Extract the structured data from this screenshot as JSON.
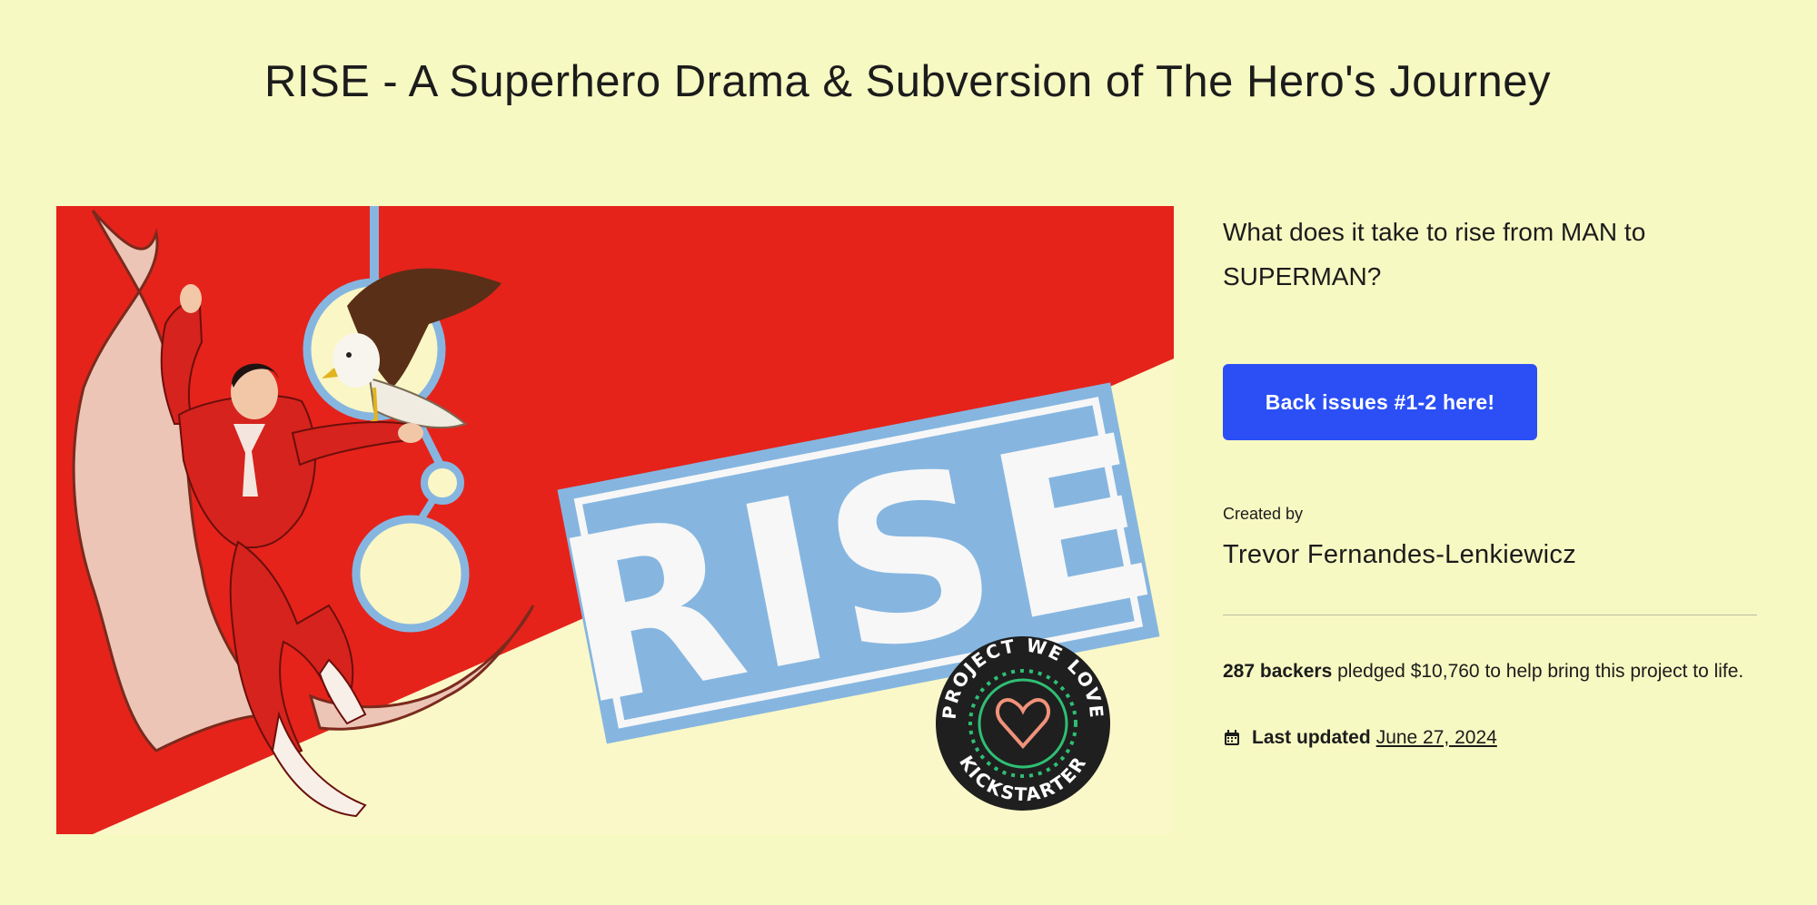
{
  "project": {
    "title": "RISE - A Superhero Drama & Subversion of The Hero's Journey",
    "blurb": "What does it take to rise from MAN to SUPERMAN?"
  },
  "hero_image": {
    "logo_text": "RISE",
    "badge_top_text": "PROJECT WE LOVE",
    "badge_bottom_text": "KICKSTARTER"
  },
  "cta": {
    "label": "Back issues #1-2 here!"
  },
  "creator": {
    "label": "Created by",
    "name": "Trevor Fernandes-Lenkiewicz"
  },
  "funding": {
    "backers": "287 backers",
    "text": "pledged $10,760 to help bring this project to life."
  },
  "updated": {
    "label": "Last updated",
    "date": "June 27, 2024"
  },
  "colors": {
    "background": "#f7f9c2",
    "button": "#2b4ff5",
    "hero_red": "#e5231b",
    "logo_blue": "#86b6e0"
  }
}
